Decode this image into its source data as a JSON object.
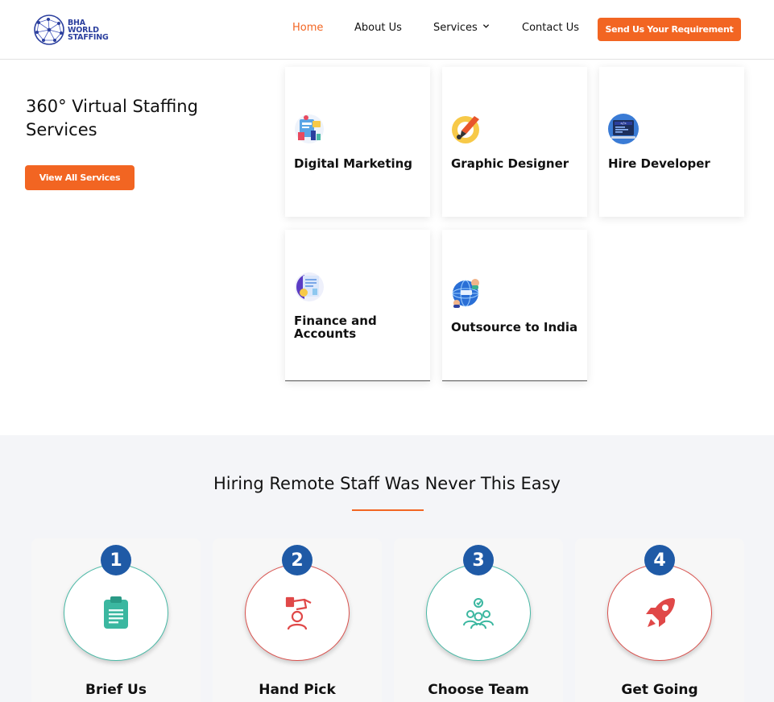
{
  "header": {
    "logo_lines": [
      "BHA",
      "WORLD",
      "STAFFING"
    ],
    "nav": {
      "home": "Home",
      "about": "About Us",
      "services": "Services",
      "contact": "Contact Us"
    },
    "cta": "Send Us Your Requirement"
  },
  "services_section": {
    "title": "360° Virtual Staffing Services",
    "view_all": "View All Services",
    "cards": [
      {
        "label": "Digital Marketing",
        "icon": "digital-marketing-icon"
      },
      {
        "label": "Graphic Designer",
        "icon": "graphic-designer-icon"
      },
      {
        "label": "Hire Developer",
        "icon": "hire-developer-icon"
      },
      {
        "label": "Finance and Accounts",
        "icon": "finance-accounts-icon"
      },
      {
        "label": "Outsource to India",
        "icon": "outsource-india-icon"
      }
    ]
  },
  "process_section": {
    "title": "Hiring Remote Staff Was Never This Easy",
    "steps": [
      {
        "number": "1",
        "label": "Brief Us",
        "icon": "clipboard-icon"
      },
      {
        "number": "2",
        "label": "Hand Pick",
        "icon": "hand-pick-icon"
      },
      {
        "number": "3",
        "label": "Choose Team",
        "icon": "team-icon"
      },
      {
        "number": "4",
        "label": "Get Going",
        "icon": "rocket-icon"
      }
    ]
  },
  "colors": {
    "accent": "#f26522",
    "brand_blue": "#2b3f9e",
    "step_number_bg": "#1f5aa6",
    "teal": "#4ab9a6",
    "red": "#d9534f"
  }
}
